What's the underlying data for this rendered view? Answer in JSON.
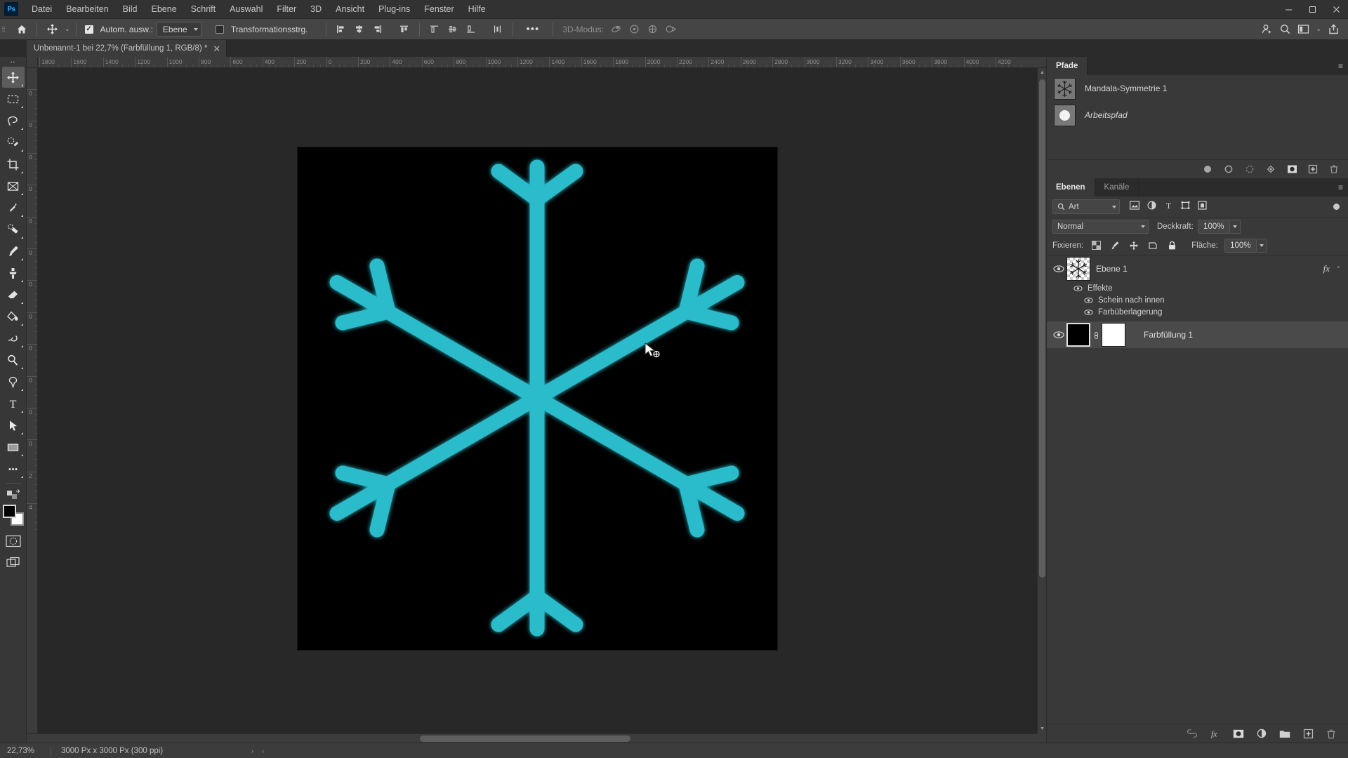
{
  "app": {
    "name": "Ps"
  },
  "menubar": {
    "items": [
      "Datei",
      "Bearbeiten",
      "Bild",
      "Ebene",
      "Schrift",
      "Auswahl",
      "Filter",
      "3D",
      "Ansicht",
      "Plug-ins",
      "Fenster",
      "Hilfe"
    ],
    "window_controls": {
      "minimize": "—",
      "maximize": "❐",
      "close": "✕"
    }
  },
  "options_bar": {
    "home_icon": "home-icon",
    "tool_icon": "move-tool-icon",
    "auto_select_label": "Autom. ausw.:",
    "auto_select_checked": true,
    "auto_select_value": "Ebene",
    "transform_controls_label": "Transformationsstrg.",
    "transform_controls_checked": false,
    "more_label": "•••",
    "mode_3d_label": "3D-Modus:"
  },
  "document_tab": {
    "title": "Unbenannt-1 bei 22,7% (Farbfüllung 1, RGB/8) *",
    "close": "✕"
  },
  "toolbar": {
    "tools": [
      {
        "name": "move-tool",
        "active": true
      },
      {
        "name": "rectangular-marquee-tool",
        "active": false
      },
      {
        "name": "lasso-tool",
        "active": false
      },
      {
        "name": "quick-selection-tool",
        "active": false
      },
      {
        "name": "crop-tool",
        "active": false
      },
      {
        "name": "frame-tool",
        "active": false
      },
      {
        "name": "eyedropper-tool",
        "active": false
      },
      {
        "name": "healing-brush-tool",
        "active": false
      },
      {
        "name": "brush-tool",
        "active": false
      },
      {
        "name": "clone-stamp-tool",
        "active": false
      },
      {
        "name": "eraser-tool",
        "active": false
      },
      {
        "name": "gradient-tool",
        "active": false
      },
      {
        "name": "blur-tool",
        "active": false
      },
      {
        "name": "dodge-tool",
        "active": false
      },
      {
        "name": "pen-tool",
        "active": false
      },
      {
        "name": "type-tool",
        "active": false
      },
      {
        "name": "path-selection-tool",
        "active": false
      },
      {
        "name": "rectangle-tool",
        "active": false
      },
      {
        "name": "more-tools",
        "active": false
      }
    ],
    "foreground_color": "#000000",
    "background_color": "#ffffff"
  },
  "rulers": {
    "horizontal_labels": [
      "1800",
      "1600",
      "1400",
      "1200",
      "1000",
      "800",
      "600",
      "400",
      "200",
      "0",
      "200",
      "400",
      "600",
      "800",
      "1000",
      "1200",
      "1400",
      "1600",
      "1800",
      "2000",
      "2200",
      "2400",
      "2600",
      "2800",
      "3000",
      "3200",
      "3400",
      "3600",
      "3800",
      "4000",
      "4200"
    ],
    "vertical_labels": [
      "0",
      "0",
      "0",
      "0",
      "0",
      "0",
      "0",
      "0",
      "0",
      "0",
      "0",
      "0",
      "2",
      "4"
    ],
    "unit": "Px"
  },
  "canvas": {
    "background_color": "#000000",
    "artwork_color": "#29bccb",
    "artwork_name": "snowflake-mandala",
    "zoom": "22,7%"
  },
  "paths_panel": {
    "tab_label": "Pfade",
    "menu_icon": "panel-menu-icon",
    "items": [
      {
        "name": "Mandala-Symmetrie 1",
        "italic": false,
        "thumb": "mandala-path-thumb"
      },
      {
        "name": "Arbeitspfad",
        "italic": true,
        "thumb": "circle-path-thumb"
      }
    ],
    "footer_icons": [
      "fill-path-icon",
      "stroke-path-icon",
      "load-selection-icon",
      "make-path-icon",
      "mask-icon",
      "new-path-icon",
      "delete-path-icon"
    ]
  },
  "layers_panel": {
    "tabs": [
      {
        "label": "Ebenen",
        "active": true
      },
      {
        "label": "Kanäle",
        "active": false
      }
    ],
    "menu_icon": "panel-menu-icon",
    "filter": {
      "kind_label": "Art",
      "search_icon": "search-icon",
      "type_icons": [
        "pixel-filter-icon",
        "adjustment-filter-icon",
        "type-filter-icon",
        "shape-filter-icon",
        "smart-object-filter-icon"
      ],
      "toggle_name": "filter-toggle"
    },
    "blend_mode": "Normal",
    "opacity_label": "Deckkraft:",
    "opacity_value": "100%",
    "lock_label": "Fixieren:",
    "lock_icons": [
      "lock-transparent-icon",
      "lock-image-icon",
      "lock-position-icon",
      "lock-artboard-icon",
      "lock-all-icon"
    ],
    "fill_label": "Fläche:",
    "fill_value": "100%",
    "layers": [
      {
        "name": "Ebene 1",
        "visible": true,
        "selected": false,
        "thumb": "snowflake-layer-thumb",
        "has_fx": true,
        "fx_mark": "fx",
        "effects_group": "Effekte",
        "effects": [
          "Schein nach innen",
          "Farbüberlagerung"
        ]
      },
      {
        "name": "Farbfüllung 1",
        "visible": true,
        "selected": true,
        "thumb": "black-fill-thumb",
        "mask_thumb": "white-mask-thumb",
        "link_icon": "mask-link-icon",
        "has_fx": false
      }
    ],
    "footer_icons": [
      "link-layers-icon",
      "add-fx-icon",
      "add-mask-icon",
      "adjustment-layer-icon",
      "new-group-icon",
      "new-layer-icon",
      "delete-layer-icon"
    ]
  },
  "status_bar": {
    "zoom": "22,73%",
    "doc_info": "3000 Px x 3000 Px (300 ppi)",
    "next_arrow": "›",
    "prev_arrow": "‹"
  },
  "top_right_icons": [
    "search-person-icon",
    "search-icon",
    "workspace-icon",
    "share-icon"
  ]
}
